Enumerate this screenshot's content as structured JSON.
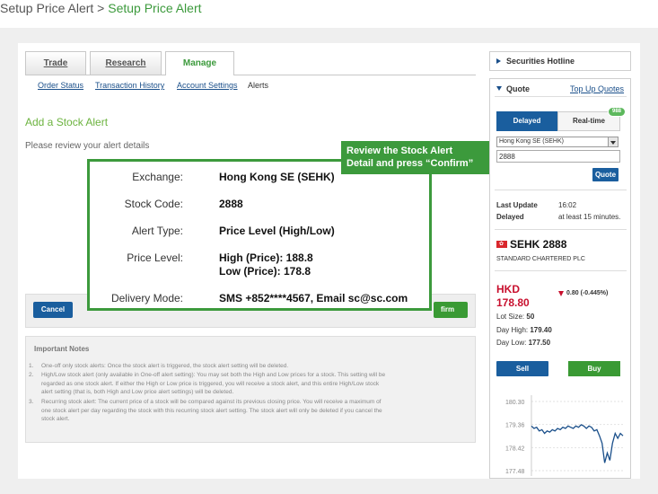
{
  "page": {
    "title_prefix": "Setup Price Alert > ",
    "title_current": "Setup Price Alert"
  },
  "tabs": [
    {
      "label": "Trade"
    },
    {
      "label": "Research"
    },
    {
      "label": "Manage",
      "active": true
    }
  ],
  "subnav": [
    "Order Status",
    "Transaction History",
    "Account Settings",
    "Alerts"
  ],
  "section_title": "Add a Stock Alert",
  "review_text": "Please review your alert details",
  "callout_hint": [
    "Review the Stock Alert",
    "Detail and press “Confirm”"
  ],
  "details": [
    {
      "label": "Exchange:",
      "value": "Hong Kong SE (SEHK)"
    },
    {
      "label": "Stock Code:",
      "value": "2888"
    },
    {
      "label": "Alert Type:",
      "value": "Price Level (High/Low)"
    },
    {
      "label": "Price Level:",
      "value": "High (Price): 188.8",
      "value2": "Low (Price): 178.8"
    },
    {
      "label": "Delivery Mode:",
      "value": "SMS +852****4567, Email sc@sc.com"
    }
  ],
  "buttons": {
    "cancel": "Cancel",
    "confirm": "Confirm",
    "confirm_visible": "firm"
  },
  "notes": {
    "title": "Important Notes",
    "items": [
      {
        "num": "1.",
        "lines": [
          "One-off only stock alerts: Once the stock alert is triggered, the stock alert setting will be deleted."
        ]
      },
      {
        "num": "2.",
        "lines": [
          "High/Low stock alert (only available in One-off alert setting): You may set both the High and Low prices for a stock. This setting will be",
          "regarded as one stock alert. If either the High or Low price is triggered, you will receive a stock alert, and this entire High/Low stock",
          "alert setting (that is, both High and Low price alert settings) will be deleted."
        ]
      },
      {
        "num": "3.",
        "lines": [
          "Recurring stock alert: The current price of a stock will be compared against its previous closing price. You will receive a maximum of",
          "one stock alert per day regarding the stock with this recurring stock alert setting. The stock alert will only be deleted if you cancel the",
          "stock alert."
        ]
      }
    ]
  },
  "sidebar": {
    "hotline": "Securities Hotline",
    "quote_title": "Quote",
    "topup": "Top Up Quotes",
    "delayed": "Delayed",
    "realtime": "Real-time",
    "realtime_badge": "988",
    "exchange_select": "Hong Kong SE (SEHK)",
    "stock_input": "2888",
    "quote_button": "Quote",
    "last_update_label": "Last Update",
    "last_update_value": "16:02",
    "delayed_label": "Delayed",
    "delayed_value": "at least 15 minutes.",
    "stock_title": "SEHK 2888",
    "company": "STANDARD CHARTERED PLC",
    "currency": "HKD",
    "price": "178.80",
    "change": "0.80 (-0.445%)",
    "lot_label": "Lot Size:",
    "lot_value": "50",
    "day_high_label": "Day High:",
    "day_high_value": "179.40",
    "day_low_label": "Day Low:",
    "day_low_value": "177.50",
    "sell": "Sell",
    "buy": "Buy",
    "colors": {
      "up_flag": "#d9262c",
      "price_red": "#c8102e",
      "accent_green": "#3c9a3c",
      "primary_blue": "#1a5e9e"
    }
  },
  "chart_data": {
    "type": "line",
    "y_ticks": [
      "180.30",
      "179.36",
      "178.42",
      "177.48"
    ],
    "ylim": [
      177.48,
      180.3
    ],
    "values": [
      179.3,
      179.2,
      179.25,
      179.1,
      179.15,
      179.0,
      179.1,
      179.05,
      179.15,
      179.1,
      179.2,
      179.15,
      179.25,
      179.2,
      179.3,
      179.25,
      179.2,
      179.3,
      179.25,
      179.35,
      179.3,
      179.2,
      179.3,
      179.25,
      179.1,
      179.15,
      178.9,
      178.6,
      177.8,
      178.2,
      177.9,
      178.6,
      179.0,
      178.8,
      179.0,
      178.9
    ]
  }
}
